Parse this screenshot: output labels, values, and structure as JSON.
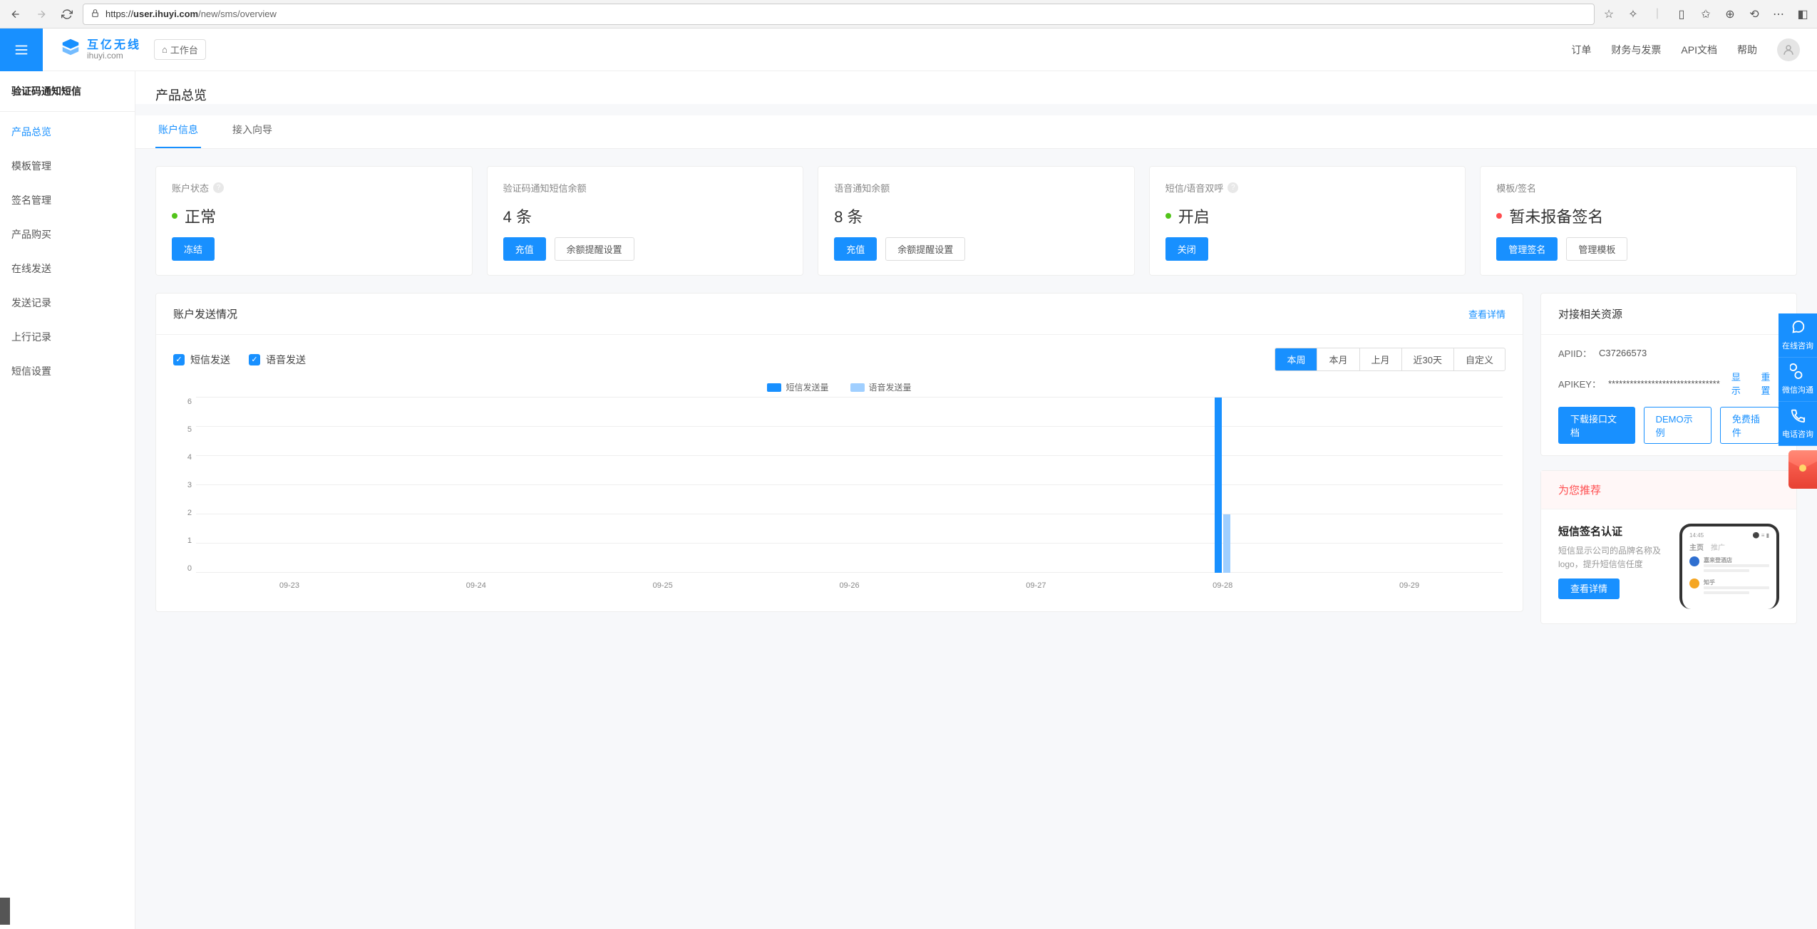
{
  "browser": {
    "url_host": "user.ihuyi.com",
    "url_path": "/new/sms/overview"
  },
  "topbar": {
    "logo_cn": "互亿无线",
    "logo_en": "ihuyi.com",
    "console_btn": "工作台",
    "links": {
      "orders": "订单",
      "finance": "财务与发票",
      "api_docs": "API文档",
      "help": "帮助"
    }
  },
  "sidebar": {
    "title": "验证码通知短信",
    "items": [
      "产品总览",
      "模板管理",
      "签名管理",
      "产品购买",
      "在线发送",
      "发送记录",
      "上行记录",
      "短信设置"
    ],
    "active_index": 0
  },
  "page_title": "产品总览",
  "tabs": {
    "items": [
      "账户信息",
      "接入向导"
    ],
    "active_index": 0
  },
  "cards": [
    {
      "title": "账户状态",
      "has_help": true,
      "dot": "green",
      "value": "正常",
      "primary_btn": "冻结",
      "secondary_btn": null
    },
    {
      "title": "验证码通知短信余额",
      "has_help": false,
      "dot": null,
      "value": "4 条",
      "primary_btn": "充值",
      "secondary_btn": "余额提醒设置"
    },
    {
      "title": "语音通知余额",
      "has_help": false,
      "dot": null,
      "value": "8 条",
      "primary_btn": "充值",
      "secondary_btn": "余额提醒设置"
    },
    {
      "title": "短信/语音双呼",
      "has_help": true,
      "dot": "green",
      "value": "开启",
      "primary_btn": "关闭",
      "secondary_btn": null
    },
    {
      "title": "模板/签名",
      "has_help": false,
      "dot": "red",
      "value": "暂未报备签名",
      "primary_btn": "管理签名",
      "secondary_btn": "管理模板"
    }
  ],
  "send_panel": {
    "title": "账户发送情况",
    "detail_link": "查看详情",
    "checkboxes": {
      "sms": "短信发送",
      "voice": "语音发送"
    },
    "ranges": [
      "本周",
      "本月",
      "上月",
      "近30天",
      "自定义"
    ],
    "active_range": 0,
    "legend": {
      "sms": "短信发送量",
      "voice": "语音发送量"
    }
  },
  "chart_data": {
    "type": "bar",
    "categories": [
      "09-23",
      "09-24",
      "09-25",
      "09-26",
      "09-27",
      "09-28",
      "09-29"
    ],
    "series": [
      {
        "name": "短信发送量",
        "values": [
          0,
          0,
          0,
          0,
          0,
          6,
          0
        ]
      },
      {
        "name": "语音发送量",
        "values": [
          0,
          0,
          0,
          0,
          0,
          2,
          0
        ]
      }
    ],
    "ylim": [
      0,
      6
    ],
    "yticks": [
      0,
      1,
      2,
      3,
      4,
      5,
      6
    ],
    "xlabel": "",
    "ylabel": ""
  },
  "resources": {
    "title": "对接相关资源",
    "apiid_label": "APIID：",
    "apiid_value": "C37266573",
    "apikey_label": "APIKEY：",
    "apikey_masked": "*******************************",
    "show": "显示",
    "reset": "重置",
    "btns": {
      "download": "下载接口文档",
      "demo": "DEMO示例",
      "plugin": "免费插件"
    }
  },
  "recommend": {
    "head": "为您推荐",
    "title": "短信签名认证",
    "desc": "短信显示公司的品牌名称及logo，提升短信信任度",
    "btn": "查看详情",
    "phone": {
      "tabs": [
        "主页",
        "推广"
      ],
      "items": [
        {
          "name": "嘉来登酒店",
          "c": "#2f6fd0"
        },
        {
          "name": "知乎",
          "c": "#f5a623"
        }
      ]
    }
  },
  "dock": {
    "items": [
      "在线咨询",
      "微信沟通",
      "电话咨询"
    ]
  }
}
